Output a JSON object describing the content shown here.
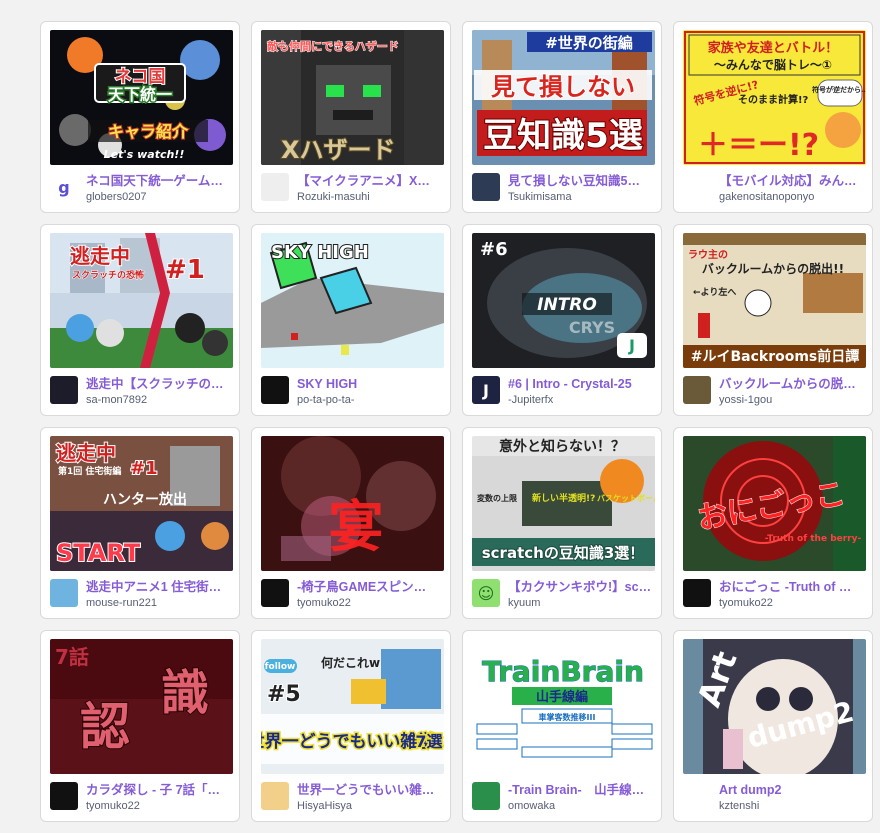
{
  "projects": [
    {
      "title": "ネコ国天下統一ゲーム…",
      "author": "globers0207",
      "thumb": {
        "texts": [
          "ネコ国",
          "天下統一",
          "キャラ紹介",
          "Let's watch!!"
        ]
      },
      "avatar": {
        "icon": "g-letter-icon",
        "label": "g",
        "bg": "#ffffff",
        "fg": "#5a4fd6"
      }
    },
    {
      "title": "【マイクラアニメ】X…",
      "author": "Rozuki-masuhi",
      "thumb": {
        "texts": [
          "敵も仲間にできるハザード",
          "Xハザード"
        ]
      },
      "avatar": {
        "icon": "cat-avatar-icon",
        "label": "",
        "bg": "#eeeeee",
        "fg": "#333333"
      }
    },
    {
      "title": "見て損しない豆知識5…",
      "author": "Tsukimisama",
      "thumb": {
        "texts": [
          "#世界の街編",
          "見て損しない",
          "豆知識5選"
        ]
      },
      "avatar": {
        "icon": "person-photo-icon",
        "label": "",
        "bg": "#2d3b55",
        "fg": "#ffffff"
      }
    },
    {
      "title": "【モバイル対応】みん…",
      "author": "gakenositanoponyo",
      "thumb": {
        "texts": [
          "家族や友達とバトル！",
          "～みんなで脳トレ～①",
          "符号を逆に!?",
          "そのまま計算!?",
          "符号が逆だから…",
          "＋＝ー!?"
        ]
      },
      "avatar": {
        "icon": "red-badge-icon",
        "label": "",
        "bg": "#ffffff",
        "fg": "#d62d2d"
      }
    },
    {
      "title": "逃走中【スクラッチの…",
      "author": "sa-mon7892",
      "thumb": {
        "texts": [
          "逃走中",
          "スクラッチの恐怖",
          "#1"
        ]
      },
      "avatar": {
        "icon": "dark-avatar-icon",
        "label": "",
        "bg": "#1c1c2a",
        "fg": "#9ec8ff"
      }
    },
    {
      "title": "SKY HIGH",
      "author": "po-ta-po-ta-",
      "thumb": {
        "texts": [
          "SKY HIGH"
        ]
      },
      "avatar": {
        "icon": "block-avatar-icon",
        "label": "",
        "bg": "#111111",
        "fg": "#7fe3ff"
      }
    },
    {
      "title": "#6 | Intro - Crystal-25",
      "author": "-Jupiterfx",
      "thumb": {
        "texts": [
          "#6",
          "INTRO",
          "CRYS"
        ]
      },
      "avatar": {
        "icon": "j-logo-icon",
        "label": "J",
        "bg": "#1d2340",
        "fg": "#ffffff"
      }
    },
    {
      "title": "バックルームからの脱…",
      "author": "yossi-1gou",
      "thumb": {
        "texts": [
          "ラウ主の",
          "バックルームからの脱出!!",
          "←より左へ",
          "#ルイBackrooms前日譚"
        ]
      },
      "avatar": {
        "icon": "room-avatar-icon",
        "label": "",
        "bg": "#6a5a3a",
        "fg": "#ffffff"
      }
    },
    {
      "title": "逃走中アニメ1 住宅街…",
      "author": "mouse-run221",
      "thumb": {
        "texts": [
          "逃走中",
          "第1回 住宅街編",
          "#1",
          "ハンター放出",
          "START"
        ]
      },
      "avatar": {
        "icon": "pixel-avatar-icon",
        "label": "",
        "bg": "#6fb3e0",
        "fg": "#ffffff"
      }
    },
    {
      "title": "-椅子鳥GAMEスピン…",
      "author": "tyomuko22",
      "thumb": {
        "texts": [
          "宴"
        ]
      },
      "avatar": {
        "icon": "dark-avatar-icon",
        "label": "",
        "bg": "#111111",
        "fg": "#777777"
      }
    },
    {
      "title": "【カクサンキボウ!】scratch…",
      "author": "kyuum",
      "thumb": {
        "texts": [
          "意外と知らない！？",
          "変数の上限",
          "新しい半透明!?",
          "バスケットボールの秘密",
          "scratchの豆知識3選！"
        ]
      },
      "avatar": {
        "icon": "smile-avatar-icon",
        "label": "☺",
        "bg": "#8fe070",
        "fg": "#1f6e1f"
      }
    },
    {
      "title": "おにごっこ -Truth of …",
      "author": "tyomuko22",
      "thumb": {
        "texts": [
          "おにごっこ",
          "-Truth of the berry-"
        ]
      },
      "avatar": {
        "icon": "dark-avatar-icon",
        "label": "",
        "bg": "#111111",
        "fg": "#777777"
      }
    },
    {
      "title": "カラダ探し - 子 7話「…",
      "author": "tyomuko22",
      "thumb": {
        "texts": [
          "7話",
          "認",
          "識"
        ]
      },
      "avatar": {
        "icon": "dark-avatar-icon",
        "label": "",
        "bg": "#111111",
        "fg": "#777777"
      }
    },
    {
      "title": "世界一どうでもいい雑…",
      "author": "HisyaHisya",
      "thumb": {
        "texts": [
          "follow",
          "何だこれw",
          "#5",
          "世界一どうでもいい雑学",
          "7選"
        ]
      },
      "avatar": {
        "icon": "shogi-piece-icon",
        "label": "",
        "bg": "#f3d08a",
        "fg": "#333333"
      }
    },
    {
      "title": "-Train Brain-　山手線…",
      "author": "omowaka",
      "thumb": {
        "texts": [
          "TrainBrain",
          "山手線編",
          "車掌客数推移III"
        ]
      },
      "avatar": {
        "icon": "green-avatar-icon",
        "label": "",
        "bg": "#2a8f4a",
        "fg": "#ffffff"
      }
    },
    {
      "title": "Art dump2",
      "author": "kztenshi",
      "thumb": {
        "texts": [
          "Art",
          "dump2"
        ]
      },
      "avatar": {
        "icon": "sketch-avatar-icon",
        "label": "",
        "bg": "#ffffff",
        "fg": "#333333"
      }
    }
  ]
}
